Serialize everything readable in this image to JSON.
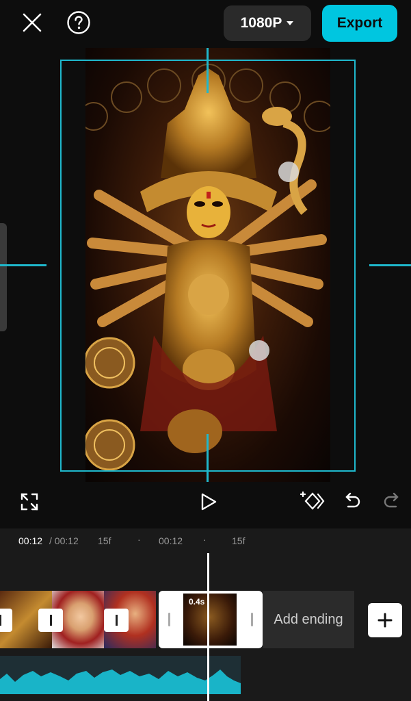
{
  "header": {
    "close_icon": "close-icon",
    "help_icon": "help-icon",
    "resolution": "1080P",
    "export_label": "Export"
  },
  "colors": {
    "accent": "#00c6e0",
    "guide": "#1fb8cc",
    "background": "#0d0d0d"
  },
  "controls": {
    "fullscreen_icon": "fullscreen-icon",
    "play_icon": "play-icon",
    "keyframe_icon": "keyframe-icon",
    "undo_icon": "undo-icon",
    "redo_icon": "redo-icon"
  },
  "ruler": {
    "current_time": "00:12",
    "total_time": "/ 00:12",
    "tick1": "15f",
    "tick2": "00:12",
    "tick3": "15f"
  },
  "timeline": {
    "selected_clip_duration": "0.4s",
    "add_ending_label": "Add ending",
    "add_clip_icon": "plus-icon"
  }
}
